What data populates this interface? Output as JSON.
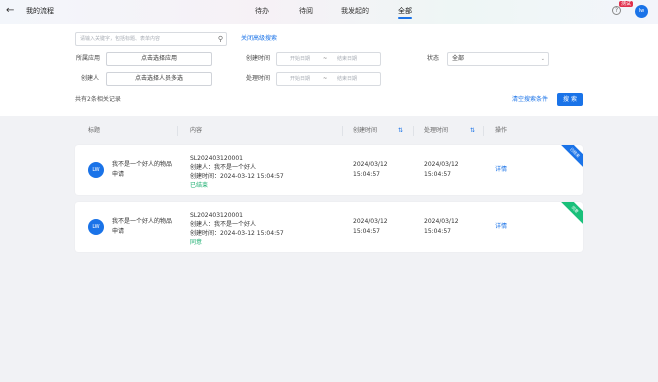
{
  "header": {
    "title": "我的流程",
    "tabs": [
      {
        "label": "待办"
      },
      {
        "label": "待阅"
      },
      {
        "label": "我发起的"
      },
      {
        "label": "全部"
      }
    ],
    "active_tab": "全部",
    "badge": "测试",
    "avatar": "lw",
    "accent_color": "#1a73e8"
  },
  "filters": {
    "search_placeholder": "请输入关键字，包括标题、表单内容",
    "advanced_toggle": "关闭高级搜索",
    "app_label": "所属应用",
    "app_button": "点击选择应用",
    "creator_label": "创建人",
    "creator_button": "点击选择人员多选",
    "created_label": "创建时间",
    "handled_label": "处理时间",
    "start_placeholder": "开始日期",
    "range_sep": "~",
    "end_placeholder": "结束日期",
    "status_label": "状态",
    "status_value": "全部",
    "clear": "清空搜索条件",
    "search": "搜 索",
    "count_text": "共有2条相关记录"
  },
  "table": {
    "columns": [
      "标题",
      "内容",
      "创建时间",
      "处理时间",
      "操作"
    ]
  },
  "records": [
    {
      "avatar": "LW",
      "title": "我不是一个好人的物品申请",
      "serial": "SL202403120001",
      "creator": "创建人：我不是一个好人",
      "created_at": "创建时间：2024-03-12 15:04:57",
      "status": "已结束",
      "status_color": "#1aae6f",
      "create_date": "2024/03/12",
      "create_time": "15:04:57",
      "handle_date": "2024/03/12",
      "handle_time": "15:04:57",
      "action": "详情",
      "ribbon": "已结束",
      "ribbon_color": "#1a73e8"
    },
    {
      "avatar": "LW",
      "title": "我不是一个好人的物品申请",
      "serial": "SL202403120001",
      "creator": "创建人：我不是一个好人",
      "created_at": "创建时间：2024-03-12 15:04:57",
      "status": "同意",
      "status_color": "#1aae6f",
      "create_date": "2024/03/12",
      "create_time": "15:04:57",
      "handle_date": "2024/03/12",
      "handle_time": "15:04:57",
      "action": "详情",
      "ribbon": "同意",
      "ribbon_color": "#19c07a"
    }
  ]
}
